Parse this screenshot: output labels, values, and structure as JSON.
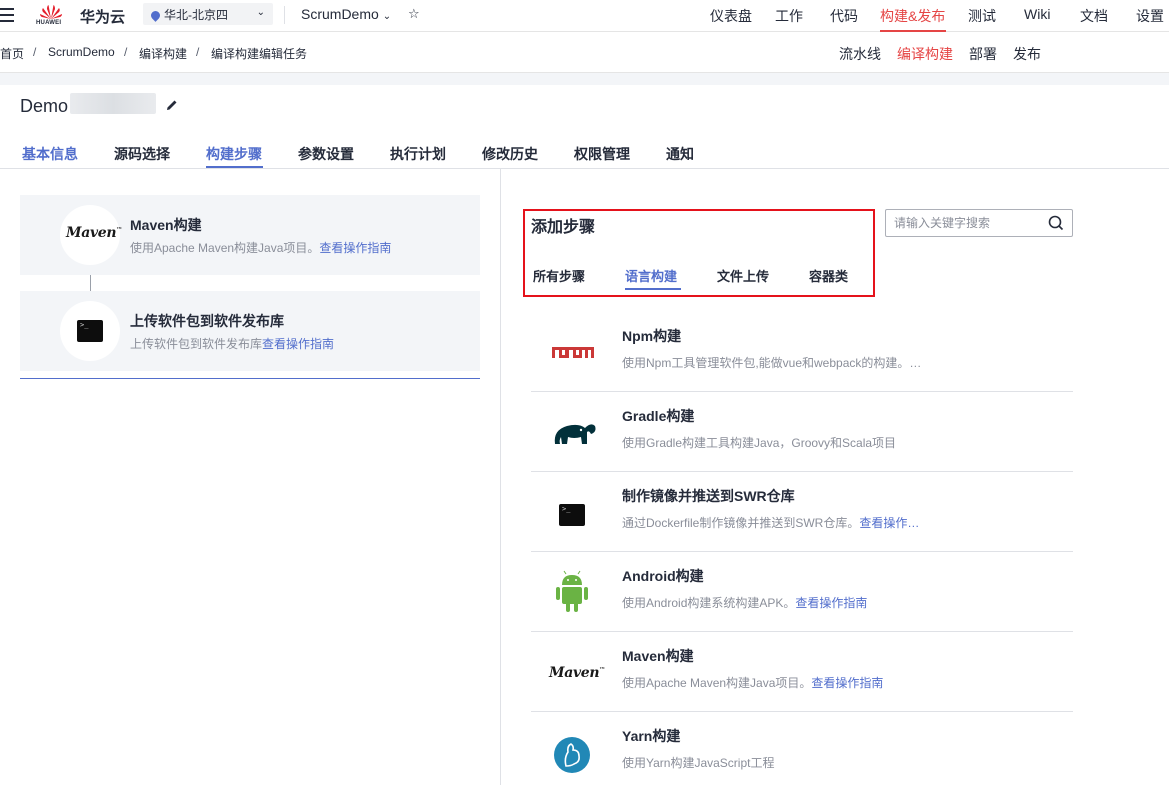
{
  "header": {
    "logo_text": "HUAWEI",
    "brand": "华为云",
    "region": "华北-北京四",
    "project": "ScrumDemo",
    "nav": [
      "仪表盘",
      "工作",
      "代码",
      "构建&发布",
      "测试",
      "Wiki",
      "文档",
      "设置"
    ],
    "active_nav": "构建&发布"
  },
  "breadcrumb": [
    "首页",
    "ScrumDemo",
    "编译构建",
    "编译构建编辑任务"
  ],
  "subnav": [
    "流水线",
    "编译构建",
    "部署",
    "发布"
  ],
  "task": {
    "title": "Demo"
  },
  "tabs": [
    "基本信息",
    "源码选择",
    "构建步骤",
    "参数设置",
    "执行计划",
    "修改历史",
    "权限管理",
    "通知"
  ],
  "steps": [
    {
      "name": "Maven构建",
      "desc": "使用Apache Maven构建Java项目。",
      "link": "查看操作指南",
      "icon": "maven-icon"
    },
    {
      "name": "上传软件包到软件发布库",
      "desc": "上传软件包到软件发布库",
      "link": "查看操作指南",
      "icon": "terminal-icon"
    }
  ],
  "add_step": {
    "title": "添加步骤",
    "categories": [
      "所有步骤",
      "语言构建",
      "文件上传",
      "容器类"
    ],
    "active_category": "语言构建",
    "search_placeholder": "请输入关键字搜索"
  },
  "items": [
    {
      "name": "Npm构建",
      "desc": "使用Npm工具管理软件包,能做vue和webpack的构建。…",
      "link": "",
      "icon": "npm-icon"
    },
    {
      "name": "Gradle构建",
      "desc": "使用Gradle构建工具构建Java，Groovy和Scala项目",
      "link": "",
      "icon": "gradle-icon"
    },
    {
      "name": "制作镜像并推送到SWR仓库",
      "desc": "通过Dockerfile制作镜像并推送到SWR仓库。",
      "link": "查看操作…",
      "icon": "terminal-icon"
    },
    {
      "name": "Android构建",
      "desc": "使用Android构建系统构建APK。",
      "link": "查看操作指南",
      "icon": "android-icon"
    },
    {
      "name": "Maven构建",
      "desc": "使用Apache Maven构建Java项目。",
      "link": "查看操作指南",
      "icon": "maven-icon"
    },
    {
      "name": "Yarn构建",
      "desc": "使用Yarn构建JavaScript工程",
      "link": "",
      "icon": "yarn-icon"
    }
  ],
  "colors": {
    "accent_red": "#e54545",
    "accent_blue": "#526ecc",
    "highlight_box": "#e5121b"
  }
}
